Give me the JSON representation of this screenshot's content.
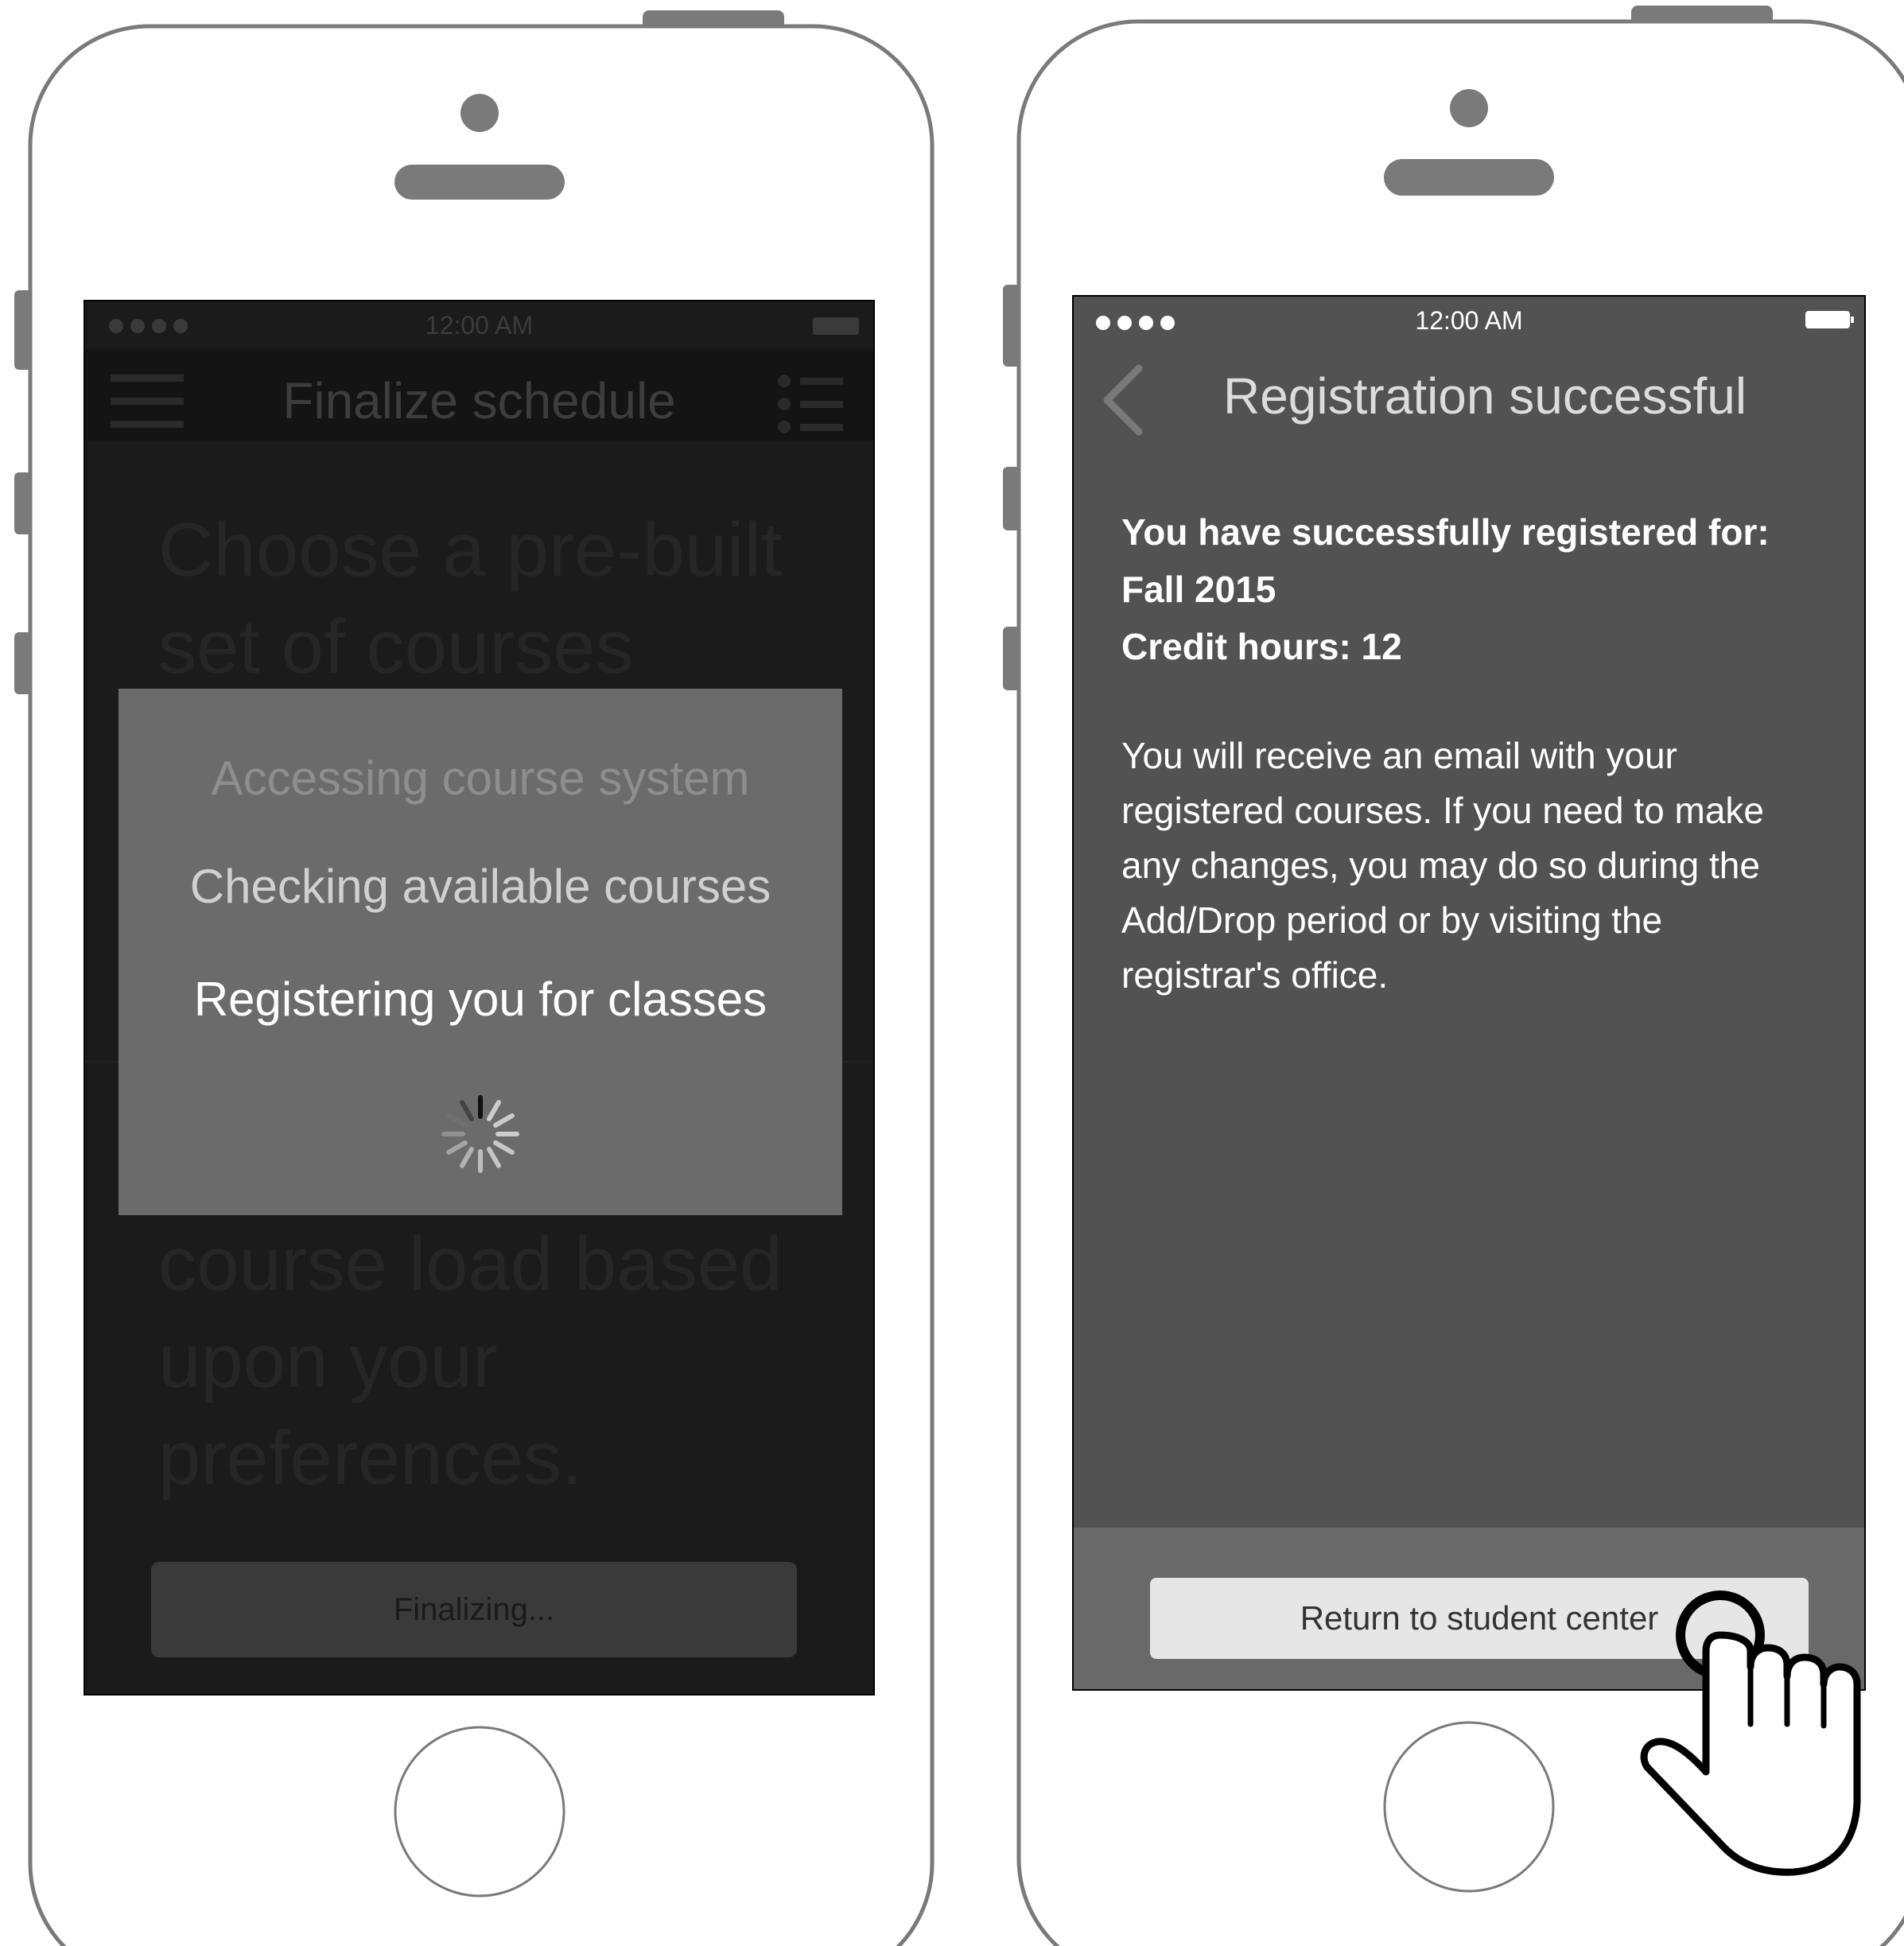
{
  "left_phone": {
    "status_time": "12:00 AM",
    "nav_title": "Finalize schedule",
    "background_text_top": [
      "Choose a pre-built",
      "set of courses"
    ],
    "background_text_bottom": [
      "course load based",
      "upon your",
      "preferences."
    ],
    "overlay_steps": [
      "Accessing course system",
      "Checking available courses",
      "Registering you for classes"
    ],
    "button_label": "Finalizing..."
  },
  "right_phone": {
    "status_time": "12:00 AM",
    "nav_title": "Registration successful",
    "summary_heading": "You have successfully registered for:",
    "term": "Fall 2015",
    "credit_hours": "Credit hours: 12",
    "message": "You will receive an email with your registered courses. If you need to make any changes, you may do so during the Add/Drop period or by visiting the registrar's office.",
    "button_label": "Return to student center"
  },
  "icons": [
    "hamburger-menu-icon",
    "list-icon",
    "loading-spinner-icon",
    "back-chevron-icon",
    "battery-icon",
    "signal-dots-icon",
    "tap-hand-icon"
  ],
  "colors": {
    "frame": "#7a7a7a",
    "left_screen": "#1b1b1b",
    "overlay": "#6b6b6b",
    "right_screen": "#525252",
    "button": "#e6e6e6"
  }
}
